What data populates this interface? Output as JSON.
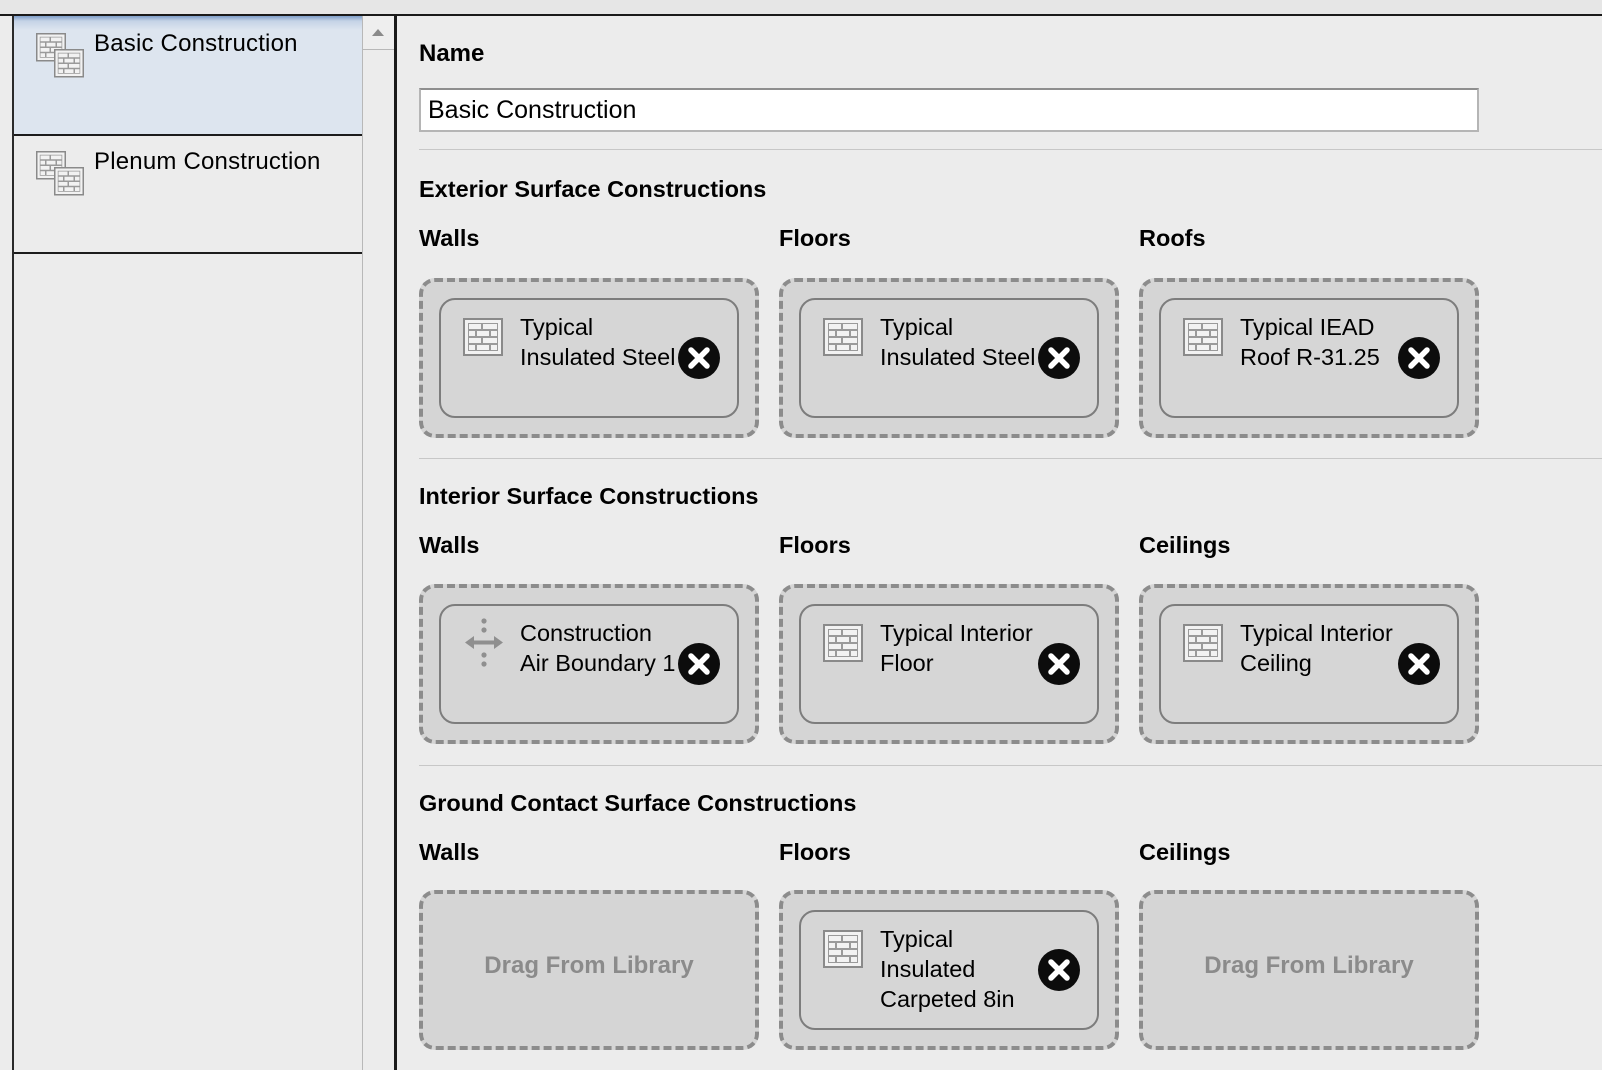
{
  "constructions_list": [
    {
      "label": "Basic Construction",
      "icon": "construction-set-icon"
    },
    {
      "label": "Plenum Construction",
      "icon": "construction-set-icon"
    }
  ],
  "name": {
    "label": "Name",
    "value": "Basic Construction"
  },
  "exterior": {
    "title": "Exterior Surface Constructions",
    "walls": {
      "label": "Walls",
      "item": "Typical Insulated Steel"
    },
    "floors": {
      "label": "Floors",
      "item": "Typical Insulated Steel"
    },
    "roofs": {
      "label": "Roofs",
      "item": "Typical IEAD Roof R-31.25"
    }
  },
  "interior": {
    "title": "Interior Surface Constructions",
    "walls": {
      "label": "Walls",
      "item": "Construction Air Boundary 1"
    },
    "floors": {
      "label": "Floors",
      "item": "Typical Interior Floor"
    },
    "ceilings": {
      "label": "Ceilings",
      "item": "Typical Interior Ceiling"
    }
  },
  "ground": {
    "title": "Ground Contact Surface Constructions",
    "walls": {
      "label": "Walls",
      "empty_text": "Drag From Library"
    },
    "floors": {
      "label": "Floors",
      "item": "Typical Insulated Carpeted 8in"
    },
    "ceilings": {
      "label": "Ceilings",
      "empty_text": "Drag From Library"
    }
  },
  "icons": {
    "construction": "construction-icon",
    "air_boundary": "air-boundary-icon",
    "remove": "remove-x-icon"
  }
}
